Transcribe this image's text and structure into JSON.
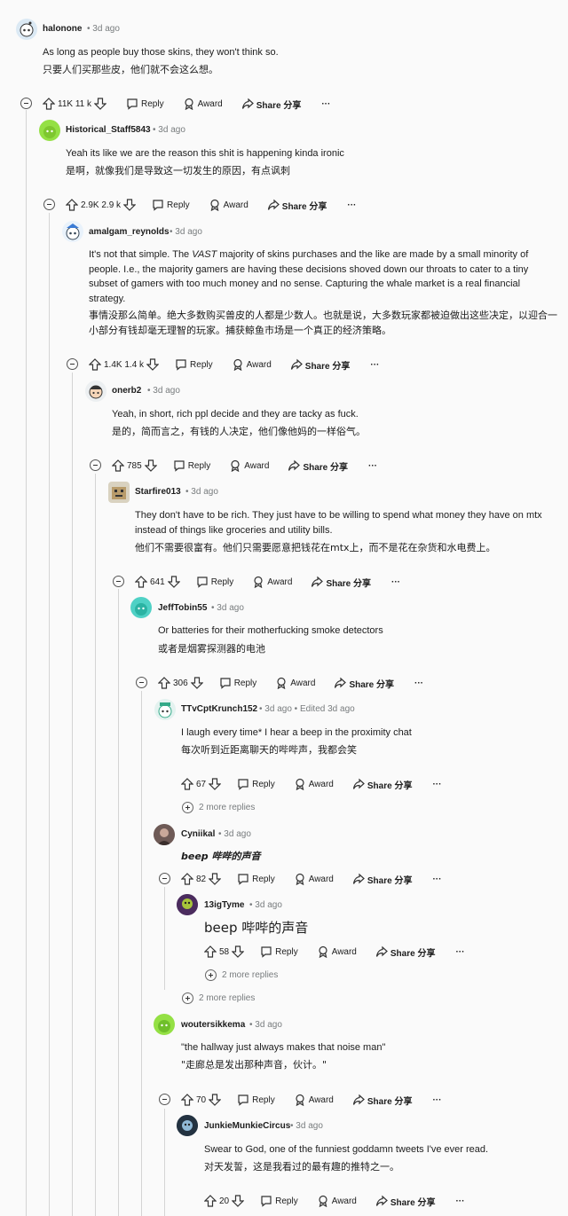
{
  "comments": [
    {
      "user": "halonone",
      "time": "3d ago",
      "en": "As long as people buy those skins, they won't think so.",
      "zh": "只要人们买那些皮，他们就不会这么想。",
      "votes": "11K 11 k"
    },
    {
      "user": "Historical_Staff5843",
      "time": "3d ago",
      "en": "Yeah its like we are the reason this shit is happening kinda ironic",
      "zh": "是啊，就像我们是导致这一切发生的原因，有点讽刺",
      "votes": "2.9K 2.9 k"
    },
    {
      "user": "amalgam_reynolds",
      "time": "3d ago",
      "en1": "It's not that simple. The ",
      "en_vast": "VAST",
      "en2": " majority of skins purchases and the like are made by a small minority of people. I.e., the majority gamers are having these decisions shoved down our throats to cater to a tiny subset of gamers with too much money and no sense. Capturing the whale market is a real financial strategy.",
      "zh": "事情没那么简单。绝大多数购买兽皮的人都是少数人。也就是说，大多数玩家都被迫做出这些决定，以迎合一小部分有钱却毫无理智的玩家。捕获鲸鱼市场是一个真正的经济策略。",
      "votes": "1.4K 1.4 k"
    },
    {
      "user": "onerb2",
      "time": "3d ago",
      "en": "Yeah, in short, rich ppl decide and they are tacky as fuck.",
      "zh": "是的，简而言之，有钱的人决定，他们像他妈的一样俗气。",
      "votes": "785"
    },
    {
      "user": "Starfire013",
      "time": "3d ago",
      "en": "They don't have to be rich. They just have to be willing to spend what money they have on mtx instead of things like groceries and utility bills.",
      "zh": "他们不需要很富有。他们只需要愿意把钱花在mtx上，而不是花在杂货和水电费上。",
      "votes": "641"
    },
    {
      "user": "JeffTobin55",
      "time": "3d ago",
      "en": "Or batteries for their motherfucking smoke detectors",
      "zh": "或者是烟雾探测器的电池",
      "votes": "306"
    },
    {
      "user": "TTvCptKrunch152",
      "time": "3d ago",
      "edited": "Edited 3d ago",
      "en": "I laugh every time* I hear a beep in the proximity chat",
      "zh": "每次听到近距离聊天的哔哔声，我都会笑",
      "votes": "67",
      "more": "2 more replies"
    },
    {
      "user": "Cyniikal",
      "time": "3d ago",
      "en": "beep 哔哔的声音",
      "votes": "82"
    },
    {
      "user": "13igTyme",
      "time": "3d ago",
      "en": "beep 哔哔的声音",
      "votes": "58",
      "more": "2 more replies"
    },
    {
      "more": "2 more replies"
    },
    {
      "user": "woutersikkema",
      "time": "3d ago",
      "en": "\"the hallway just always makes that noise man\"",
      "zh": "\"走廊总是发出那种声音，伙计。\"",
      "votes": "70"
    },
    {
      "user": "JunkieMunkieCircus",
      "time": "3d ago",
      "en": "Swear to God, one of the funniest goddamn tweets I've ever read.",
      "zh": "对天发誓，这是我看过的最有趣的推特之一。",
      "votes": "20"
    }
  ],
  "actions": {
    "reply": "Reply",
    "award": "Award",
    "share": "Share 分享",
    "dots": "···",
    "sep": "•"
  },
  "colors": {
    "line": "#d4d4d4",
    "meta": "#787c7e"
  }
}
